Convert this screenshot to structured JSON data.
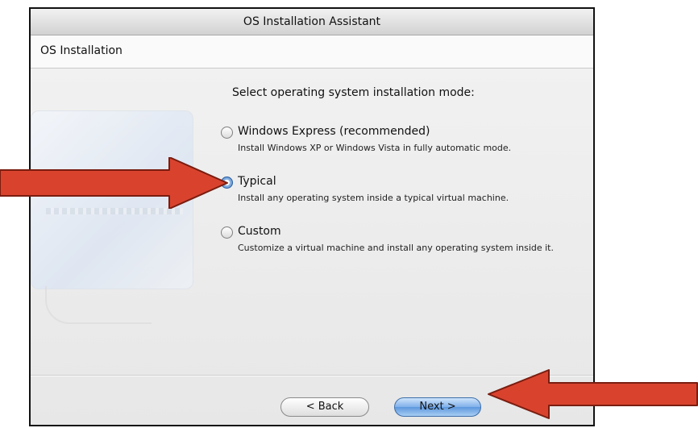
{
  "window": {
    "title": "OS Installation Assistant"
  },
  "header": {
    "title": "OS Installation"
  },
  "main": {
    "prompt": "Select operating system installation mode:",
    "options": [
      {
        "label": "Windows Express (recommended)",
        "description": "Install Windows XP or Windows Vista in fully automatic mode.",
        "selected": false
      },
      {
        "label": "Typical",
        "description": "Install any operating system inside a typical virtual machine.",
        "selected": true
      },
      {
        "label": "Custom",
        "description": "Customize a virtual machine and install any operating system inside it.",
        "selected": false
      }
    ]
  },
  "buttons": {
    "back": "< Back",
    "next": "Next >"
  },
  "colors": {
    "arrow": "#d9432e",
    "default_button": "#5d97dd"
  }
}
